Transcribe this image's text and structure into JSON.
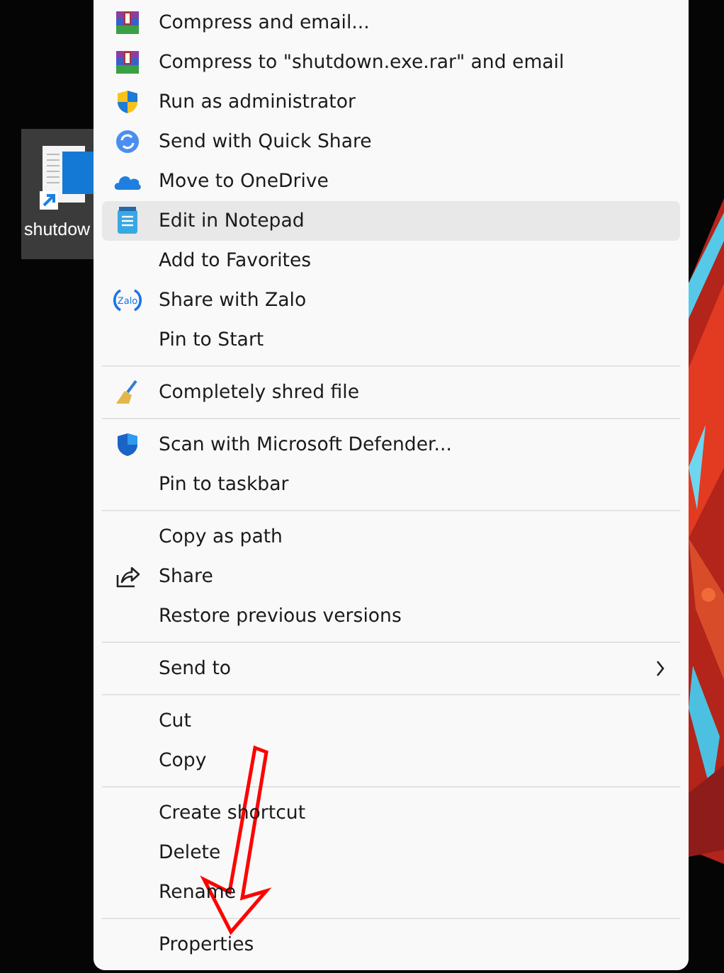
{
  "desktop": {
    "shortcut": {
      "label": "shutdow",
      "selected": true
    }
  },
  "context_menu": {
    "groups": [
      {
        "items": [
          {
            "label": "Compress and email...",
            "kind": "archive",
            "selected": false
          },
          {
            "label": "Compress to \"shutdown.exe.rar\" and email",
            "kind": "archive",
            "selected": false
          },
          {
            "label": "Run as administrator",
            "kind": "uac-shield",
            "selected": false
          },
          {
            "label": "Send with Quick Share",
            "kind": "quick-share",
            "selected": false
          },
          {
            "label": "Move to OneDrive",
            "kind": "cloud",
            "selected": false
          },
          {
            "label": "Edit in Notepad",
            "kind": "notepad",
            "selected": true
          },
          {
            "label": "Add to Favorites",
            "kind": "plain",
            "selected": false
          },
          {
            "label": "Share with Zalo",
            "kind": "zalo",
            "icon_text": "Zalo",
            "selected": false
          },
          {
            "label": "Pin to Start",
            "kind": "plain",
            "selected": false
          }
        ]
      },
      {
        "items": [
          {
            "label": "Completely shred file",
            "kind": "broom",
            "selected": false
          }
        ]
      },
      {
        "items": [
          {
            "label": "Scan with Microsoft Defender...",
            "kind": "defender",
            "selected": false
          },
          {
            "label": "Pin to taskbar",
            "kind": "plain",
            "selected": false
          }
        ]
      },
      {
        "items": [
          {
            "label": "Copy as path",
            "kind": "plain",
            "selected": false
          },
          {
            "label": "Share",
            "kind": "share",
            "selected": false
          },
          {
            "label": "Restore previous versions",
            "kind": "plain",
            "selected": false
          }
        ]
      },
      {
        "items": [
          {
            "label": "Send to",
            "kind": "plain",
            "submenu": true,
            "selected": false
          }
        ]
      },
      {
        "items": [
          {
            "label": "Cut",
            "kind": "plain",
            "selected": false
          },
          {
            "label": "Copy",
            "kind": "plain",
            "selected": false
          }
        ]
      },
      {
        "items": [
          {
            "label": "Create shortcut",
            "kind": "plain",
            "selected": false
          },
          {
            "label": "Delete",
            "kind": "plain",
            "selected": false
          },
          {
            "label": "Rename",
            "kind": "plain",
            "selected": false
          }
        ]
      },
      {
        "items": [
          {
            "label": "Properties",
            "kind": "plain",
            "selected": false
          }
        ]
      }
    ]
  }
}
